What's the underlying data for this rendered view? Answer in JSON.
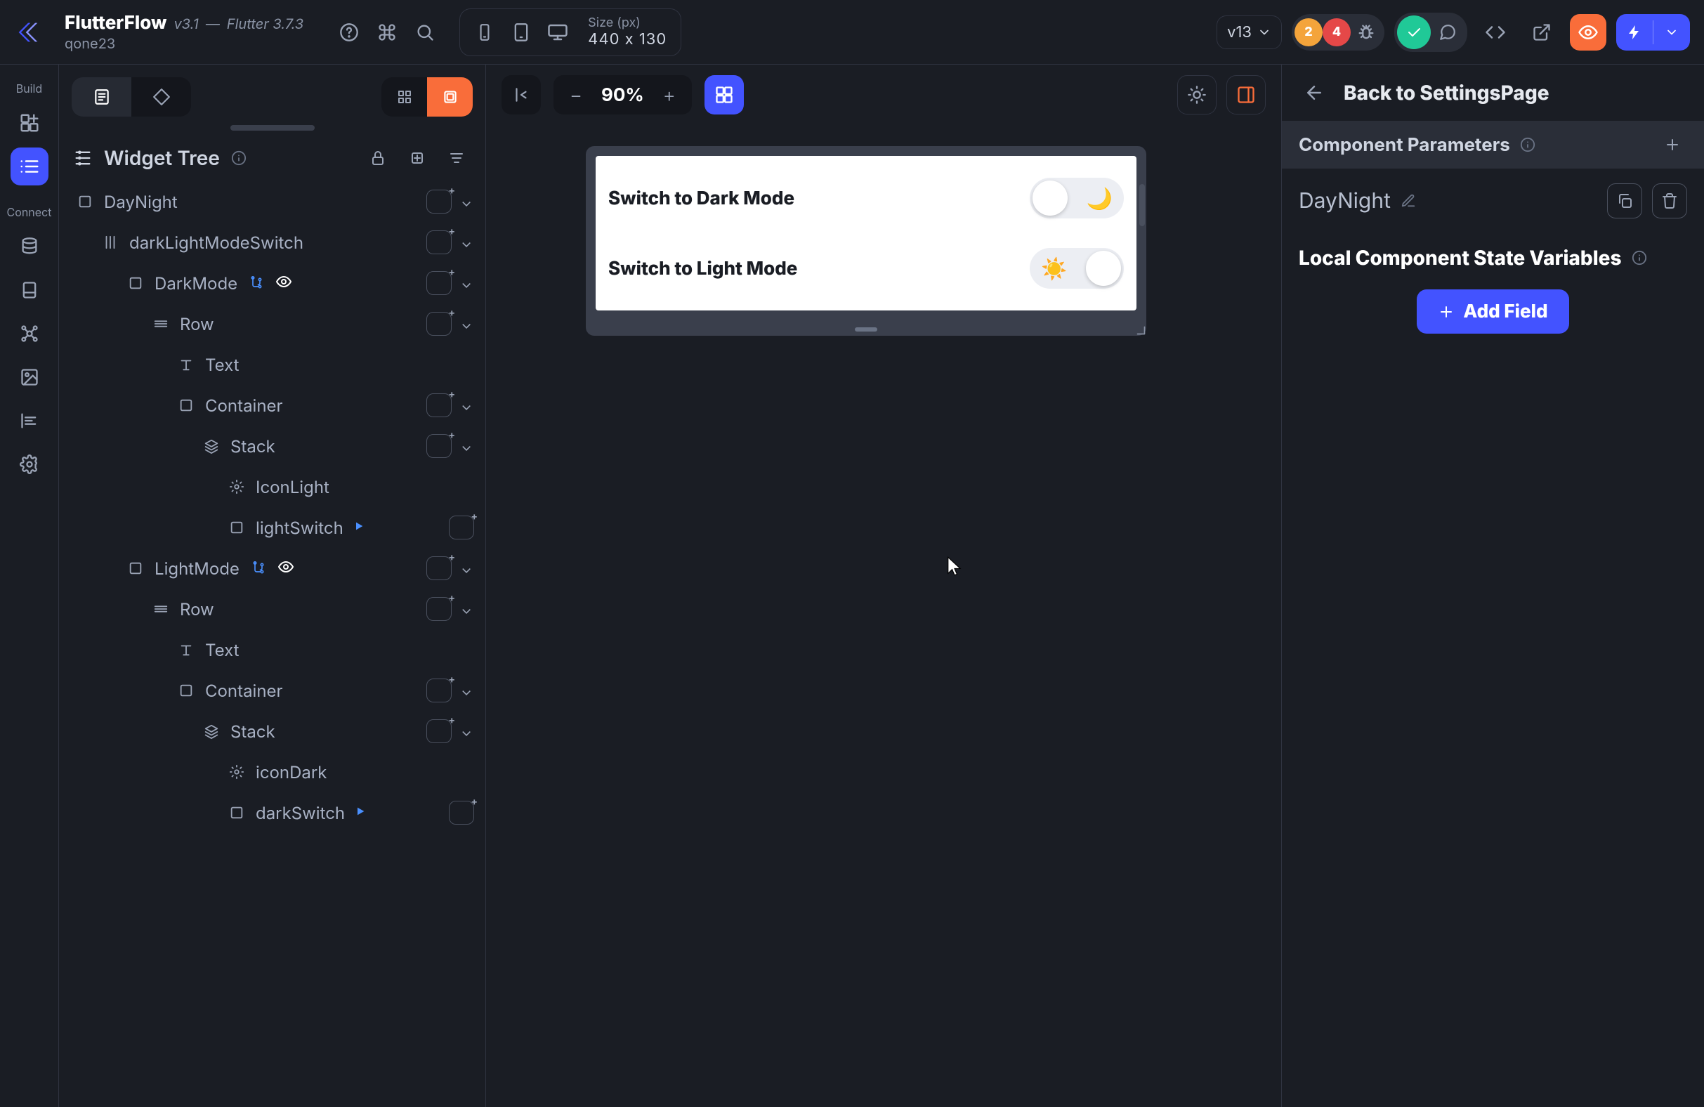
{
  "header": {
    "app_name": "FlutterFlow",
    "app_version": "v3.1",
    "dash": "—",
    "flutter_version": "Flutter 3.7.3",
    "username": "qone23",
    "size_label": "Size (px)",
    "size_value": "440 x 130",
    "project_version": "v13",
    "warn_badge": "2",
    "error_badge": "4"
  },
  "leftrail": {
    "build_label": "Build",
    "connect_label": "Connect"
  },
  "panel": {
    "title": "Widget Tree",
    "tree": {
      "n0": "DayNight",
      "n1": "darkLightModeSwitch",
      "n2": "DarkMode",
      "n3": "Row",
      "n4": "Text",
      "n5": "Container",
      "n6": "Stack",
      "n7": "IconLight",
      "n8": "lightSwitch",
      "n9": "LightMode",
      "n10": "Row",
      "n11": "Text",
      "n12": "Container",
      "n13": "Stack",
      "n14": "iconDark",
      "n15": "darkSwitch"
    }
  },
  "canvas": {
    "zoom": "90%",
    "row1_text": "Switch to Dark Mode",
    "row2_text": "Switch to Light Mode"
  },
  "right": {
    "back_label": "Back to SettingsPage",
    "section_title": "Component Parameters",
    "component_name": "DayNight",
    "state_title": "Local Component State Variables",
    "add_field": "Add Field"
  }
}
